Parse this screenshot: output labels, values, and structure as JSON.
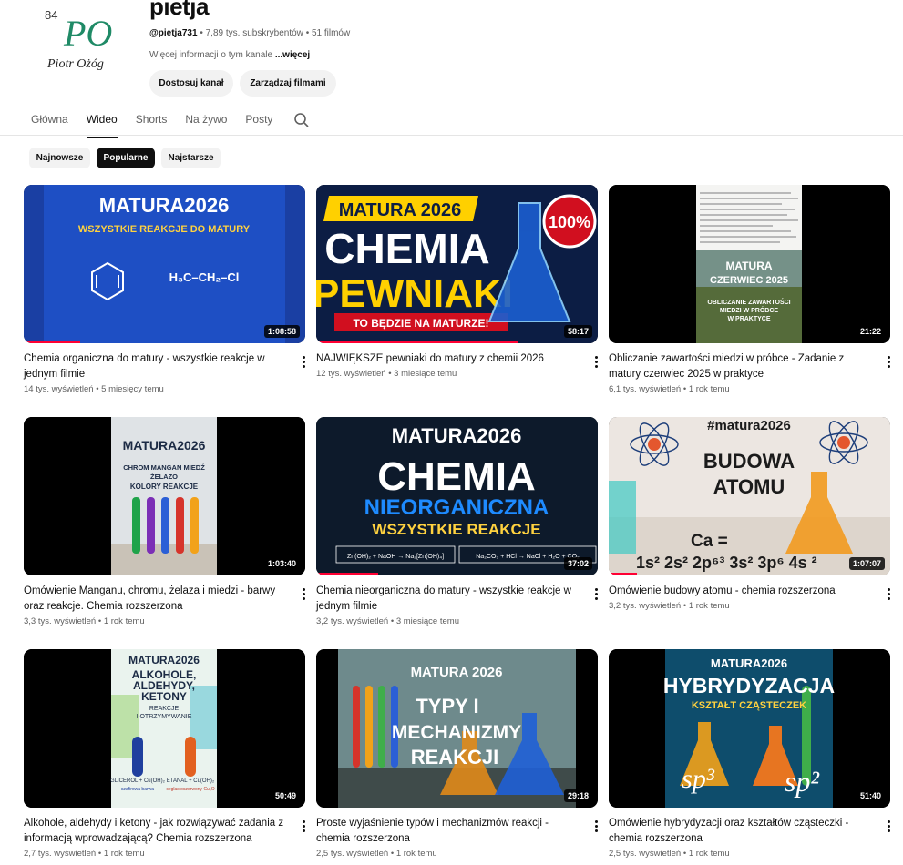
{
  "channel": {
    "avatar_number": "84",
    "avatar_monogram": "PO",
    "avatar_signature": "Piotr Ożóg",
    "name": "pietja",
    "handle": "@pietja731",
    "subscribers": "7,89 tys. subskrybentów",
    "videos_count": "51 filmów",
    "description": "Więcej informacji o tym kanale",
    "more_label": "...więcej",
    "customize_button": "Dostosuj kanał",
    "manage_button": "Zarządzaj filmami"
  },
  "tabs": [
    {
      "label": "Główna"
    },
    {
      "label": "Wideo"
    },
    {
      "label": "Shorts"
    },
    {
      "label": "Na żywo"
    },
    {
      "label": "Posty"
    }
  ],
  "chips": [
    {
      "label": "Najnowsze"
    },
    {
      "label": "Popularne"
    },
    {
      "label": "Najstarsze"
    }
  ],
  "videos": [
    {
      "title": "Chemia organiczna do matury - wszystkie reakcje w jednym filmie",
      "views": "14 tys. wyświetleń",
      "age": "5 miesięcy temu",
      "duration": "1:08:58",
      "watched": 0.2,
      "thumb": {
        "line1": "MATURA2026",
        "line2": "WSZYSTKIE REAKCJE DO MATURY",
        "formula": "H₃C–CH₂–Cl"
      }
    },
    {
      "title": "NAJWIĘKSZE pewniaki do matury z chemii 2026",
      "views": "12 tys. wyświetleń",
      "age": "3 miesiące temu",
      "duration": "58:17",
      "watched": 0.72,
      "thumb": {
        "line1": "MATURA 2026",
        "line2": "CHEMIA",
        "line3": "PEWNIAKI",
        "line4": "TO BĘDZIE NA MATURZE!",
        "badge": "100%"
      }
    },
    {
      "title": "Obliczanie zawartości miedzi w próbce - Zadanie z matury czerwiec 2025 w praktyce",
      "views": "6,1 tys. wyświetleń",
      "age": "1 rok temu",
      "duration": "21:22",
      "watched": 0,
      "thumb": {
        "line1": "MATURA",
        "line2": "CZERWIEC 2025",
        "line3": "OBLICZANIE ZAWARTOŚCI",
        "line4": "MIEDZI W PRÓBCE",
        "line5": "W PRAKTYCE"
      }
    },
    {
      "title": "Omówienie Manganu, chromu, żelaza i miedzi - barwy oraz reakcje. Chemia rozszerzona",
      "views": "3,3 tys. wyświetleń",
      "age": "1 rok temu",
      "duration": "1:03:40",
      "watched": 0,
      "thumb": {
        "line1": "MATURA2026",
        "line2": "CHROM  MANGAN  MIEDŹ",
        "line3": "ŻELAZO",
        "line4": "KOLORY      REAKCJE"
      }
    },
    {
      "title": "Chemia nieorganiczna do matury - wszystkie reakcje w jednym filmie",
      "views": "3,2 tys. wyświetleń",
      "age": "3 miesiące temu",
      "duration": "37:02",
      "watched": 0.22,
      "thumb": {
        "line1": "MATURA2026",
        "line2": "CHEMIA",
        "line3": "NIEORGANICZNA",
        "line4": "WSZYSTKIE REAKCJE",
        "eq1": "Zn(OH)₂ + NaOH → Na₂[Zn(OH)₄]",
        "eq2": "Na₂CO₃ + HCl → NaCl + H₂O + CO₂"
      }
    },
    {
      "title": "Omówienie budowy atomu  - chemia rozszerzona",
      "views": "3,2 tys. wyświetleń",
      "age": "1 rok temu",
      "duration": "1:07:07",
      "watched": 0.1,
      "thumb": {
        "line1": "#matura2026",
        "line2": "BUDOWA",
        "line3": "ATOMU",
        "line4": "Ca =",
        "line5": "1s² 2s² 2p⁶³ 3s² 3p⁶ 4s ²"
      }
    },
    {
      "title": "Alkohole, aldehydy i ketony - jak rozwiązywać zadania z informacją wprowadzającą? Chemia rozszerzona",
      "views": "2,7 tys. wyświetleń",
      "age": "1 rok temu",
      "duration": "50:49",
      "watched": 0,
      "thumb": {
        "line1": "MATURA2026",
        "line2": "ALKOHOLE,",
        "line3": "ALDEHYDY,",
        "line4": "KETONY",
        "line5": "REAKCJE",
        "line6": "I OTRZYMYWANIE",
        "left_label": "GLICEROL + Cu(OH)₂",
        "left_sub": "szafirowa barwa",
        "right_label": "ETANAL + Cu(OH)₂",
        "right_sub": "ceglastoczerwony Cu₂O"
      }
    },
    {
      "title": "Proste wyjaśnienie typów i mechanizmów reakcji - chemia rozszerzona",
      "views": "2,5 tys. wyświetleń",
      "age": "1 rok temu",
      "duration": "29:18",
      "watched": 0,
      "thumb": {
        "line1": "MATURA 2026",
        "line2": "TYPY I",
        "line3": "MECHANIZMY",
        "line4": "REAKCJI"
      }
    },
    {
      "title": "Omówienie hybrydyzacji oraz kształtów cząsteczki - chemia rozszerzona",
      "views": "2,5 tys. wyświetleń",
      "age": "1 rok temu",
      "duration": "51:40",
      "watched": 0,
      "thumb": {
        "line1": "MATURA2026",
        "line2": "HYBRYDYZACJA",
        "line3": "KSZTAŁT CZĄSTECZEK",
        "left": "sp³",
        "right": "sp²"
      }
    }
  ]
}
